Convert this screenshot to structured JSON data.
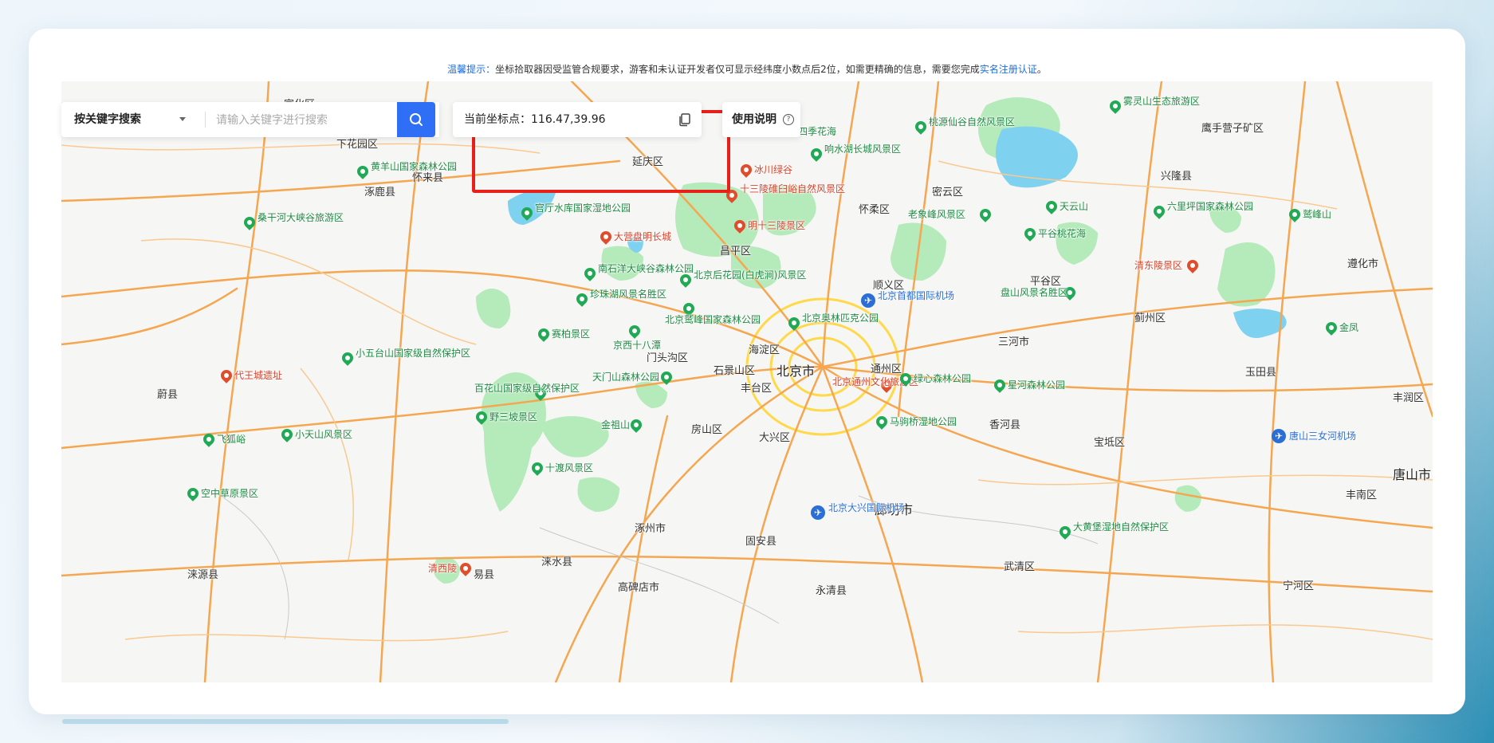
{
  "notice": {
    "prefix": "温馨提示：",
    "body": "坐标拾取器因受监管合规要求，游客和未认证开发者仅可显示经纬度小数点后2位，如需更精确的信息，需要您完成",
    "link": "实名注册认证",
    "suffix": "。"
  },
  "search": {
    "mode_label": "按关键字搜索",
    "placeholder": "请输入关键字进行搜索",
    "button_icon": "search-icon"
  },
  "coordinate": {
    "label": "当前坐标点：",
    "value": "116.47,39.96",
    "copy_icon": "copy-icon"
  },
  "help": {
    "label": "使用说明",
    "icon": "question-circle-icon"
  },
  "colors": {
    "accent": "#2f6ff5",
    "highlight": "#e8201a",
    "scenic": "#21a956",
    "road": "#f5a650"
  },
  "map": {
    "districts": [
      "宣化区",
      "下花园区",
      "怀来县",
      "涿鹿县",
      "延庆区",
      "昌平区",
      "怀柔区",
      "密云区",
      "兴隆县",
      "鹰手营子矿区",
      "平谷区",
      "顺义区",
      "海淀区",
      "门头沟区",
      "石景山区",
      "丰台区",
      "通州区",
      "三河市",
      "蓟州区",
      "玉田县",
      "遵化市",
      "丰润区",
      "房山区",
      "大兴区",
      "香河县",
      "宝坻区",
      "廊坊市",
      "涿州市",
      "固安县",
      "涞水县",
      "易县",
      "高碑店市",
      "永清县",
      "武清区",
      "宁河区",
      "丰南区",
      "蔚县",
      "涞源县",
      "涿鹿县"
    ],
    "city": "北京市",
    "city2": "唐山市",
    "scenic": [
      "黄羊山国家森林公园",
      "桑干河大峡谷旅游区",
      "官厅水库国家湿地公园",
      "冰川绿谷",
      "十三陵碓臼峪自然风景区",
      "明十三陵景区",
      "大营盘明长城",
      "南石洋大峡谷森林公园",
      "珍珠湖风景名胜区",
      "北京后花园(白虎涧)风景区",
      "北京鹫峰国家森林公园",
      "北京奥林匹克公园",
      "赛柏景区",
      "京西十八潭",
      "小五台山国家级自然保护区",
      "代王城遗址",
      "天门山森林公园",
      "百花山国家级自然保护区",
      "野三坡景区",
      "金祖山",
      "十渡风景区",
      "飞狐峪",
      "小天山风景区",
      "空中草原景区",
      "清西陵",
      "响水湖长城风景区",
      "四季花海",
      "桃源仙谷自然风景区",
      "雾灵山生态旅游区",
      "老象峰风景区",
      "天云山",
      "平谷桃花海",
      "六里坪国家森林公园",
      "鹫峰山",
      "清东陵景区",
      "盘山风景名胜区",
      "金凤",
      "北京通州文化旅游区",
      "绿心森林公园",
      "星河森林公园",
      "马驹桥湿地公园",
      "大黄堡湿地自然保护区"
    ],
    "airports": [
      "北京首都国际机场",
      "北京大兴国际机场",
      "唐山三女河机场"
    ]
  }
}
